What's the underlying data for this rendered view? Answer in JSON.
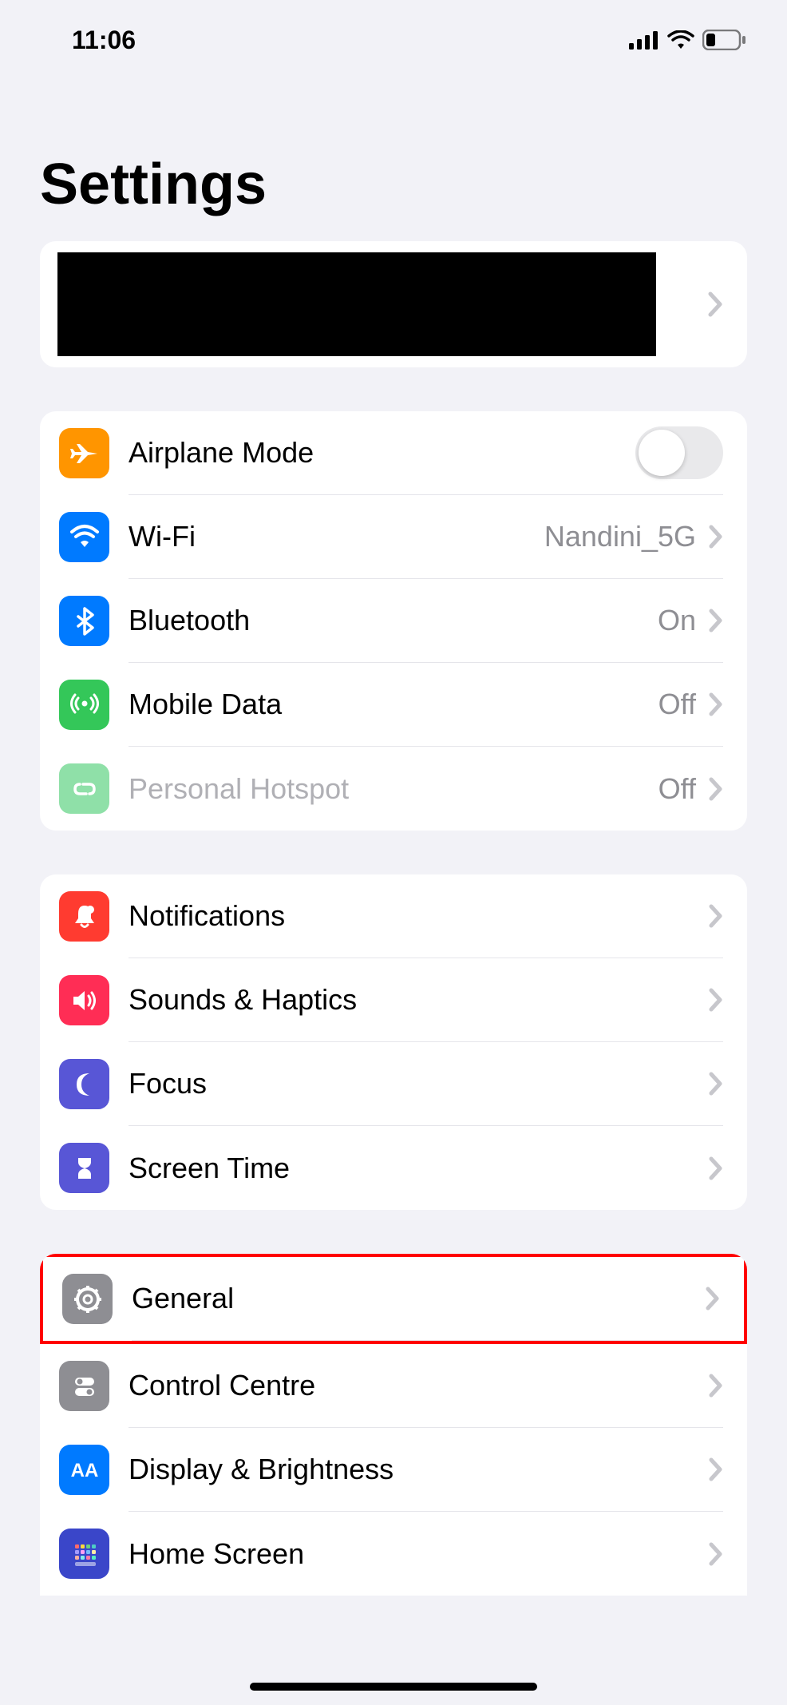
{
  "status": {
    "time": "11:06",
    "signal_icon": "cellular-signal-icon",
    "wifi_icon": "wifi-icon",
    "battery_icon": "battery-low-icon"
  },
  "title": "Settings",
  "profile": {
    "redacted": true
  },
  "group1": [
    {
      "id": "airplane",
      "label": "Airplane Mode",
      "icon": "airplane-icon",
      "icon_bg": "#ff9500",
      "toggle": false
    },
    {
      "id": "wifi",
      "label": "Wi-Fi",
      "icon": "wifi-icon",
      "icon_bg": "#007aff",
      "value": "Nandini_5G",
      "chevron": true
    },
    {
      "id": "bluetooth",
      "label": "Bluetooth",
      "icon": "bluetooth-icon",
      "icon_bg": "#007aff",
      "value": "On",
      "chevron": true
    },
    {
      "id": "mobiledata",
      "label": "Mobile Data",
      "icon": "antenna-icon",
      "icon_bg": "#34c759",
      "value": "Off",
      "chevron": true
    },
    {
      "id": "hotspot",
      "label": "Personal Hotspot",
      "icon": "hotspot-icon",
      "icon_bg": "#8fe0a8",
      "value": "Off",
      "chevron": true,
      "disabled": true
    }
  ],
  "group2": [
    {
      "id": "notifications",
      "label": "Notifications",
      "icon": "bell-icon",
      "icon_bg": "#ff3b30",
      "chevron": true
    },
    {
      "id": "sounds",
      "label": "Sounds & Haptics",
      "icon": "speaker-icon",
      "icon_bg": "#ff2d55",
      "chevron": true
    },
    {
      "id": "focus",
      "label": "Focus",
      "icon": "moon-icon",
      "icon_bg": "#5856d6",
      "chevron": true
    },
    {
      "id": "screentime",
      "label": "Screen Time",
      "icon": "hourglass-icon",
      "icon_bg": "#5856d6",
      "chevron": true
    }
  ],
  "group3": [
    {
      "id": "general",
      "label": "General",
      "icon": "gear-icon",
      "icon_bg": "#8e8e93",
      "chevron": true,
      "highlighted": true
    },
    {
      "id": "controlcentre",
      "label": "Control Centre",
      "icon": "toggles-icon",
      "icon_bg": "#8e8e93",
      "chevron": true
    },
    {
      "id": "display",
      "label": "Display & Brightness",
      "icon": "aa-icon",
      "icon_bg": "#007aff",
      "chevron": true
    },
    {
      "id": "homescreen",
      "label": "Home Screen",
      "icon": "homegrid-icon",
      "icon_bg": "#3a46c9",
      "chevron": true
    }
  ]
}
